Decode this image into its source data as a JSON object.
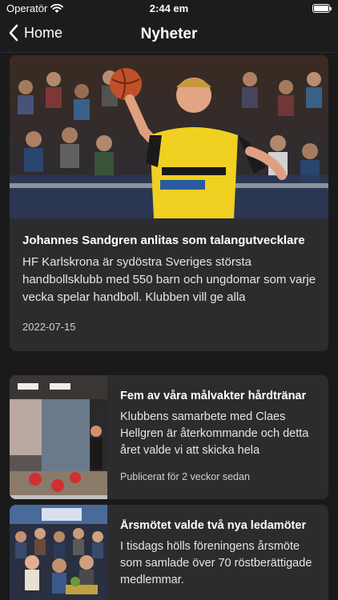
{
  "status": {
    "carrier": "Operatör",
    "time": "2:44 em"
  },
  "nav": {
    "back_label": "Home",
    "title": "Nyheter"
  },
  "articles": [
    {
      "title": "Johannes Sandgren anlitas som talangutvecklare",
      "excerpt": "HF Karlskrona är sydöstra Sveriges största handbollsklubb med 550 barn och ungdomar som varje vecka spelar handboll. Klubben vill ge alla",
      "meta": "2022-07-15",
      "image_icon": "handball-player-photo"
    },
    {
      "title": "Fem av våra målvakter hårdtränar",
      "excerpt": "Klubbens samarbete med Claes Hellgren är återkommande och detta året valde vi att skicka hela",
      "meta": "Publicerat för 2 veckor sedan",
      "image_icon": "goalkeeper-training-photo"
    },
    {
      "title": "Årsmötet valde två nya ledamöter",
      "excerpt": "I tisdags hölls föreningens årsmöte som samlade över 70 röstberättigade medlemmar.",
      "meta": "",
      "image_icon": "annual-meeting-photo"
    }
  ],
  "colors": {
    "background": "#1c1c1e",
    "card": "#2c2c2e",
    "accent": "#f5d90a"
  }
}
